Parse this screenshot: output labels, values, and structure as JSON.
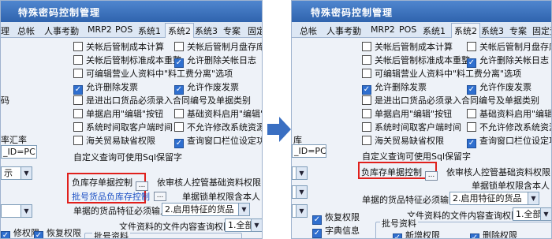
{
  "app_title": "特殊密码控制管理",
  "left": {
    "tabs": [
      "理",
      "总帐",
      "人事考勤",
      "MRP2",
      "POS",
      "系统1",
      "系统2",
      "系统3",
      "专案",
      "固定资"
    ],
    "active_tab_index": 6,
    "options": [
      {
        "label": "关帐后管制成本计算",
        "checked": false
      },
      {
        "label": "关帐后管制月盘存库存重",
        "checked": false
      },
      {
        "label": "关帐后管制标准成本重整",
        "checked": false
      },
      {
        "label": "允许删除关帐日志",
        "checked": true
      },
      {
        "label": "可编辑营业人资料中\"料工费分离\"选项",
        "checked": false
      },
      {
        "label": "允许删除发票",
        "checked": true
      },
      {
        "label": "允许作废发票",
        "checked": true
      },
      {
        "label": "是进出口货品必须录入合同编号及单据类别",
        "checked": false
      },
      {
        "label": "单据启用\"编辑\"按钮",
        "checked": false
      },
      {
        "label": "基础资料启用\"编辑\"按钮",
        "checked": false
      },
      {
        "label": "系统时间取客户端时间",
        "checked": false
      },
      {
        "label": "不允许修改系统资源",
        "checked": false
      },
      {
        "label": "海关贸易缺省权限",
        "checked": false
      },
      {
        "label": "查询窗口栏位设定功能",
        "checked": true
      }
    ],
    "sql_label": "自定义查询可使用Sql保留字",
    "edge_label_1": "码",
    "edge_label_2": "率汇率",
    "edge_input": "_ID=PC",
    "edge_combo_1": "示",
    "edge_combo_2": "",
    "bottom_check_left": {
      "label": "修权限",
      "checked": true
    },
    "bottom_check_right": {
      "label": "恢复权限",
      "checked": true
    },
    "bottom_group": "批号资料",
    "red_links": [
      "负库存单据控制",
      "批号货品负库存控制"
    ],
    "dots": "...",
    "audit_label": "依审核人控管基础资料权限",
    "lock_label": "单据锁单权限含本人",
    "feature_label": "单据的货品特征必须输入",
    "feature_value": "2.启用特征的货品",
    "doc_query_label": "文件资料的文件内容查询权限",
    "doc_query_value": "1.全部"
  },
  "right": {
    "tabs": [
      "总帐",
      "人事考勤",
      "MRP2",
      "POS",
      "系统1",
      "系统2",
      "系统3",
      "专案",
      "固定资"
    ],
    "active_tab_index": 5,
    "options": [
      {
        "label": "关帐后管制成本计算",
        "checked": false
      },
      {
        "label": "关帐后管制月盘存库存",
        "checked": false
      },
      {
        "label": "关帐后管制标准成本重整",
        "checked": false
      },
      {
        "label": "允许删除关帐日志",
        "checked": true
      },
      {
        "label": "可编辑营业人资料中\"料工费分离\"选项",
        "checked": false
      },
      {
        "label": "允许删除发票",
        "checked": true
      },
      {
        "label": "允许作废发票",
        "checked": true
      },
      {
        "label": "是进出口货品必须录入合同编号及单据类别",
        "checked": false
      },
      {
        "label": "单据启用\"编辑\"按钮",
        "checked": false
      },
      {
        "label": "基础资料启用\"编辑\"按",
        "checked": false
      },
      {
        "label": "系统时间取客户端时间",
        "checked": false
      },
      {
        "label": "不允许修改系统资源",
        "checked": false
      },
      {
        "label": "海关贸易缺省权限",
        "checked": false
      },
      {
        "label": "查询窗口栏位设定功能",
        "checked": true
      }
    ],
    "sql_label": "自定义查询可使用Sql保留字",
    "edge_label": "库",
    "edge_input": "_ID=PC",
    "edge_combo_1": "",
    "edge_combo_2": "",
    "edge_combo_3": "",
    "red_link": "负库存单据控制",
    "dots": "...",
    "audit_label": "依审核人控管基础资料权限",
    "lock_label": "单据锁单权限含本人",
    "feature_label": "单据的货品特征必须输入",
    "feature_value": "2.启用特征的货品",
    "doc_query_label": "文件资料的文件内容查询权限",
    "doc_query_value": "1.全部",
    "bottom_checks": [
      {
        "label": "恢复权限",
        "checked": true
      },
      {
        "label": "字典信息",
        "checked": true
      }
    ],
    "bottom_group": "批号资料",
    "bottom_group_checks": [
      {
        "label": "新增权限",
        "checked": true
      },
      {
        "label": "删除权限",
        "checked": true
      }
    ]
  },
  "colors": {
    "accent": "#2f63ad",
    "highlight_box": "#e0201c",
    "arrow": "#3a6fc2"
  }
}
